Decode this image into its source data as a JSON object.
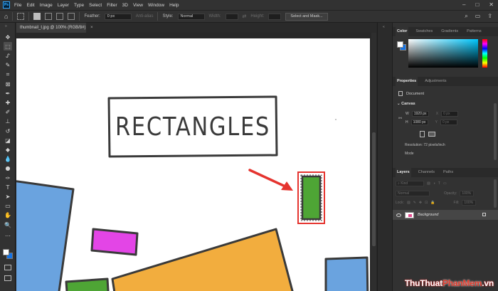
{
  "app": {
    "logo": "Ps"
  },
  "menu": [
    "File",
    "Edit",
    "Image",
    "Layer",
    "Type",
    "Select",
    "Filter",
    "3D",
    "View",
    "Window",
    "Help"
  ],
  "window_controls": [
    "–",
    "□",
    "✕"
  ],
  "options": {
    "feather_label": "Feather:",
    "feather_value": "0 px",
    "antialias_label": "Anti-alias",
    "style_label": "Style:",
    "style_value": "Normal",
    "width_label": "Width:",
    "height_label": "Height:",
    "select_mask_button": "Select and Mask...",
    "right_icons": [
      "⌕",
      "▭",
      "⇪"
    ]
  },
  "tools": [
    {
      "icon": "move-icon",
      "glyph": "✥"
    },
    {
      "icon": "marquee-icon",
      "glyph": "⬚"
    },
    {
      "icon": "lasso-icon",
      "glyph": "ᔑ"
    },
    {
      "icon": "quick-select-icon",
      "glyph": "✎"
    },
    {
      "icon": "crop-icon",
      "glyph": "⌗"
    },
    {
      "icon": "frame-icon",
      "glyph": "⊠"
    },
    {
      "icon": "eyedropper-icon",
      "glyph": "✒"
    },
    {
      "icon": "healing-icon",
      "glyph": "✚"
    },
    {
      "icon": "brush-icon",
      "glyph": "✐"
    },
    {
      "icon": "stamp-icon",
      "glyph": "⊥"
    },
    {
      "icon": "history-brush-icon",
      "glyph": "↺"
    },
    {
      "icon": "eraser-icon",
      "glyph": "◪"
    },
    {
      "icon": "bucket-icon",
      "glyph": "◆"
    },
    {
      "icon": "blur-icon",
      "glyph": "💧"
    },
    {
      "icon": "dodge-icon",
      "glyph": "●"
    },
    {
      "icon": "pen-icon",
      "glyph": "✑"
    },
    {
      "icon": "type-icon",
      "glyph": "T"
    },
    {
      "icon": "path-select-icon",
      "glyph": "➤"
    },
    {
      "icon": "shape-icon",
      "glyph": "▭"
    },
    {
      "icon": "hand-icon",
      "glyph": "✋"
    },
    {
      "icon": "zoom-icon",
      "glyph": "🔍"
    },
    {
      "icon": "more-icon",
      "glyph": "…"
    }
  ],
  "document": {
    "tab_title": "thumbnail_t.jpg @ 100% (RGB/8#)",
    "close": "×"
  },
  "canvas": {
    "title_text": "RECTANGLES",
    "colors": {
      "blue": "#6aa3df",
      "magenta": "#e345e6",
      "orange": "#f2ad3e",
      "green": "#4ea535",
      "outline": "#3a3a3a",
      "arrow": "#e5342f",
      "highlight": "#e5342f"
    }
  },
  "color_panel": {
    "tabs": [
      "Color",
      "Swatches",
      "Gradients",
      "Patterns"
    ],
    "foreground": "#ffffff",
    "background": "#1473e6"
  },
  "properties": {
    "tabs": [
      "Properties",
      "Adjustments"
    ],
    "doc_label": "Document",
    "section": "Canvas",
    "w_label": "W",
    "w_value": "1920 px",
    "x_label": "X",
    "x_value": "0 px",
    "h_label": "H",
    "h_value": "1080 px",
    "y_label": "Y",
    "y_value": "0 px",
    "resolution": "Resolution: 72 pixels/inch",
    "mode": "Mode"
  },
  "layers": {
    "tabs": [
      "Layers",
      "Channels",
      "Paths"
    ],
    "kind": "Kind",
    "blend": "Normal",
    "opacity_label": "Opacity:",
    "opacity_value": "100%",
    "lock_label": "Lock:",
    "fill_label": "Fill:",
    "fill_value": "100%",
    "layer_name": "Background"
  },
  "watermark": {
    "part1": "ThuThuat",
    "part2": "PhanMem",
    "part3": ".vn"
  }
}
